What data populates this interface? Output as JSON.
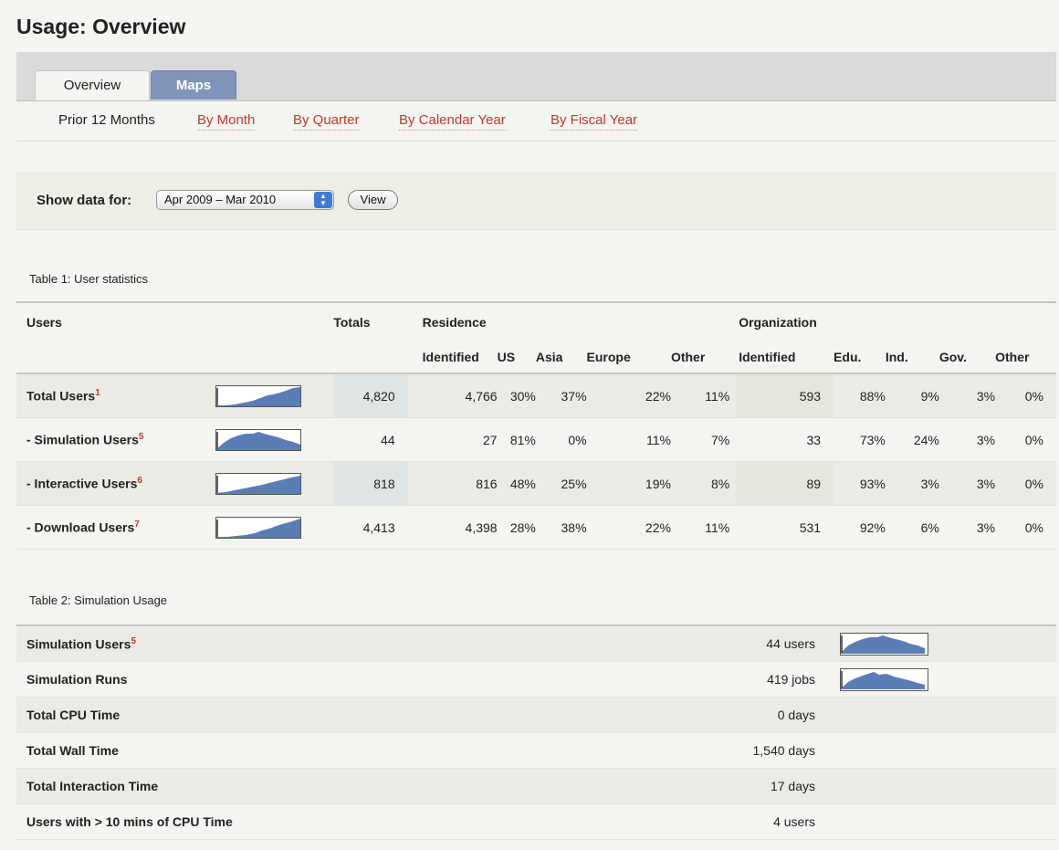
{
  "page": {
    "title": "Usage: Overview"
  },
  "tabs": [
    {
      "label": "Overview"
    },
    {
      "label": "Maps"
    }
  ],
  "subnav": [
    {
      "label": "Prior 12 Months"
    },
    {
      "label": "By Month"
    },
    {
      "label": "By Quarter"
    },
    {
      "label": "By Calendar Year"
    },
    {
      "label": "By Fiscal Year"
    }
  ],
  "filter": {
    "label": "Show data for:",
    "selected": "Apr 2009 – Mar 2010",
    "view_button": "View"
  },
  "table1": {
    "caption": "Table 1: User statistics",
    "headers": {
      "users": "Users",
      "totals": "Totals",
      "residence": "Residence",
      "organization": "Organization",
      "residence_cols": [
        "Identified",
        "US",
        "Asia",
        "Europe",
        "Other"
      ],
      "organization_cols": [
        "Identified",
        "Edu.",
        "Ind.",
        "Gov.",
        "Other"
      ]
    },
    "rows": [
      {
        "label": "Total Users",
        "note": "1",
        "total": "4,820",
        "residence": [
          "4,766",
          "30%",
          "37%",
          "22%",
          "11%"
        ],
        "organization": [
          "593",
          "88%",
          "9%",
          "3%",
          "0%"
        ]
      },
      {
        "label": "- Simulation Users",
        "note": "5",
        "total": "44",
        "residence": [
          "27",
          "81%",
          "0%",
          "11%",
          "7%"
        ],
        "organization": [
          "33",
          "73%",
          "24%",
          "3%",
          "0%"
        ]
      },
      {
        "label": "- Interactive Users",
        "note": "6",
        "total": "818",
        "residence": [
          "816",
          "48%",
          "25%",
          "19%",
          "8%"
        ],
        "organization": [
          "89",
          "93%",
          "3%",
          "3%",
          "0%"
        ]
      },
      {
        "label": "- Download Users",
        "note": "7",
        "total": "4,413",
        "residence": [
          "4,398",
          "28%",
          "38%",
          "22%",
          "11%"
        ],
        "organization": [
          "531",
          "92%",
          "6%",
          "3%",
          "0%"
        ]
      }
    ]
  },
  "table2": {
    "caption": "Table 2: Simulation Usage",
    "rows": [
      {
        "label": "Simulation Users",
        "note": "5",
        "value": "44 users",
        "sparkline": true
      },
      {
        "label": "Simulation Runs",
        "note": "",
        "value": "419 jobs",
        "sparkline": true
      },
      {
        "label": "Total CPU Time",
        "note": "",
        "value": "0 days",
        "sparkline": false
      },
      {
        "label": "Total Wall Time",
        "note": "",
        "value": "1,540 days",
        "sparkline": false
      },
      {
        "label": "Total Interaction Time",
        "note": "",
        "value": "17 days",
        "sparkline": false
      },
      {
        "label": "Users with > 10 mins of CPU Time",
        "note": "",
        "value": "4 users",
        "sparkline": false
      }
    ]
  },
  "colors": {
    "link": "#c0392b",
    "sparkline_fill": "#5b7db6",
    "maps_tab": "#8194b9"
  }
}
